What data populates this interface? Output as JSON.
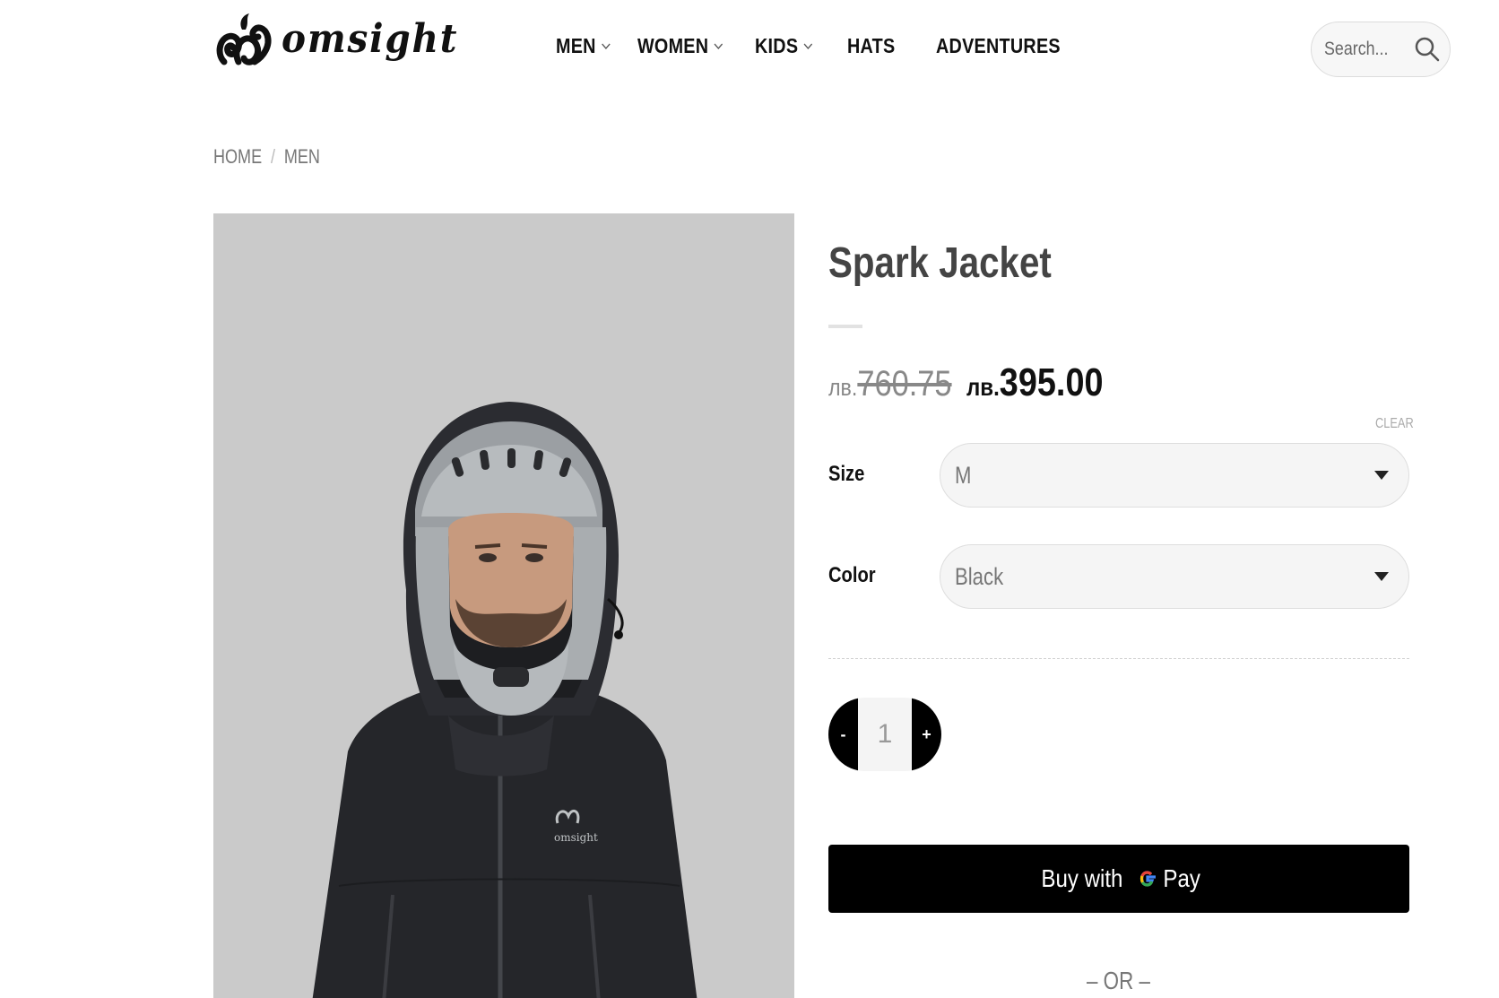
{
  "header": {
    "logo_text": "omsight",
    "nav": [
      {
        "label": "MEN",
        "has_dropdown": true
      },
      {
        "label": "WOMEN",
        "has_dropdown": true
      },
      {
        "label": "KIDS",
        "has_dropdown": true
      },
      {
        "label": "HATS",
        "has_dropdown": false
      },
      {
        "label": "ADVENTURES",
        "has_dropdown": false
      }
    ],
    "search": {
      "placeholder": "Search...",
      "icon": "search-icon"
    }
  },
  "breadcrumb": {
    "items": [
      "HOME",
      "MEN"
    ],
    "separator": "/"
  },
  "product": {
    "title": "Spark Jacket",
    "image_alt": "Man wearing black Spark Jacket with hood over grey full-face helmet",
    "old_price": {
      "currency": "лв.",
      "amount": "760.75"
    },
    "new_price": {
      "currency": "лв.",
      "amount": "395.00"
    },
    "clear_label": "CLEAR",
    "options": [
      {
        "label": "Size",
        "value": "M"
      },
      {
        "label": "Color",
        "value": "Black"
      }
    ],
    "quantity": {
      "minus": "-",
      "value": "1",
      "plus": "+"
    },
    "buy_button": {
      "text": "Buy with",
      "pay_text": "Pay"
    },
    "or_separator": "– OR –"
  },
  "colors": {
    "accent": "#000000",
    "image_bg": "#cacaca",
    "jacket": "#26272b"
  }
}
